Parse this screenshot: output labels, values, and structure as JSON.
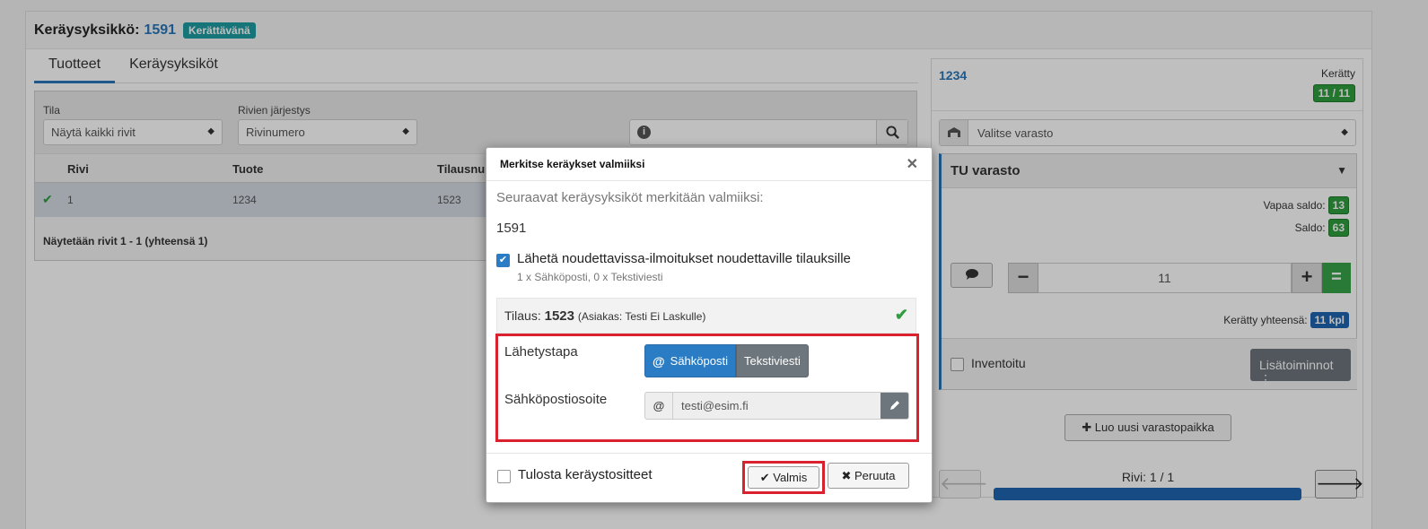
{
  "header": {
    "title": "Keräysyksikkö:",
    "unit_number": "1591",
    "status": "Kerättävänä"
  },
  "tabs": [
    "Tuotteet",
    "Keräysyksiköt"
  ],
  "filters": {
    "tila_label": "Tila",
    "tila_value": "Näytä kaikki rivit",
    "order_label": "Rivien järjestys",
    "order_value": "Rivinumero"
  },
  "table": {
    "columns": [
      "Rivi",
      "Tuote",
      "Tilausnu"
    ],
    "rows": [
      {
        "rivi": "1",
        "tuote": "1234",
        "tilaus": "1523"
      }
    ],
    "footer": "Näytetään rivit 1 - 1 (yhteensä 1)"
  },
  "right_panel": {
    "product_code": "1234",
    "collected_label": "Kerätty",
    "collected_count": "11 / 11",
    "warehouse_placeholder": "Valitse varasto",
    "warehouse_name": "TU varasto",
    "free_balance_label": "Vapaa saldo:",
    "free_balance": "13",
    "balance_label": "Saldo:",
    "balance": "63",
    "quantity": "11",
    "total_label": "Kerätty yhteensä:",
    "total_value": "11 kpl",
    "inventoried_label": "Inventoitu",
    "more_actions": "Lisätoiminnot",
    "new_location": "Luo uusi varastopaikka",
    "row_label": "Rivi: 1 / 1",
    "row_progress": 1.0
  },
  "modal": {
    "title": "Merkitse keräykset valmiiksi",
    "intro": "Seuraavat keräysyksiköt merkitään valmiiksi:",
    "unit": "1591",
    "notify_label": "Lähetä noudettavissa-ilmoitukset noudettaville tilauksille",
    "notify_sub": "1 x Sähköposti, 0 x Tekstiviesti",
    "order_prefix": "Tilaus:",
    "order_number": "1523",
    "order_customer": "(Asiakas: Testi Ei Laskulle)",
    "method_label": "Lähetystapa",
    "method_email": "Sähköposti",
    "method_sms": "Tekstiviesti",
    "email_label": "Sähköpostiosoite",
    "email_value": "testi@esim.fi",
    "print_label": "Tulosta keräystositteet",
    "done_button": "Valmis",
    "cancel_button": "Peruuta"
  },
  "colors": {
    "accent": "#2a7dc4",
    "success": "#2e9e3e",
    "highlight": "#d9222d"
  }
}
